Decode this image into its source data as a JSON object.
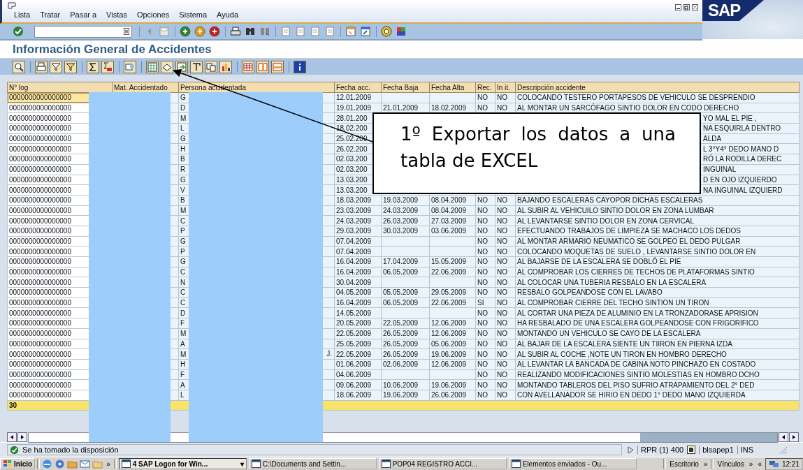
{
  "window": {
    "menu": [
      "Lista",
      "Tratar",
      "Pasar a",
      "Vistas",
      "Opciones",
      "Sistema",
      "Ayuda"
    ],
    "logo": "SAP"
  },
  "title": "Información General de Accidentes",
  "table": {
    "columns": [
      "N° log",
      "Mat. Accidentado",
      "Persona accidentada",
      "Fecha acc.",
      "Fecha Baja",
      "Fecha Alta",
      "Rec.",
      "In it.",
      "Descripción accidente"
    ],
    "rows": [
      {
        "kind": "full",
        "selected": true,
        "log": "0000000000000000",
        "persona": "G",
        "fecha_acc": "12.01.2009",
        "rec": "NO",
        "init": "NO",
        "desc": "COLOCANDO TESTERO PORTAPESOS DE VEHICULO SE DESPRENDIO"
      },
      {
        "kind": "full",
        "selected": false,
        "log": "0000000000000000",
        "persona": "D",
        "fecha_acc": "19.01.2009",
        "fecha_baja": "21.01.2009",
        "fecha_alta": "18.02.2009",
        "rec": "NO",
        "init": "NO",
        "desc": "AL MONTAR UN SARCÓFAGO SINTIO DOLOR EN CODO DERECHO"
      },
      {
        "kind": "covered",
        "selected": false,
        "log": "0000000000000000",
        "persona": "M",
        "fecha_acc": "28.01.200",
        "desc": "YO MAL EL PIE ,"
      },
      {
        "kind": "covered",
        "selected": false,
        "log": "0000000000000000",
        "persona": "L",
        "fecha_acc": "18.02.200",
        "desc": "NA ESQUIRLA DENTRO"
      },
      {
        "kind": "covered",
        "selected": false,
        "log": "0000000000000000",
        "persona": "G",
        "fecha_acc": "25.02.200",
        "desc": "ALDA"
      },
      {
        "kind": "covered",
        "selected": false,
        "log": "0000000000000000",
        "persona": "H",
        "fecha_acc": "26.02.200",
        "desc": "L 3°Y4° DEDO MANO D"
      },
      {
        "kind": "covered",
        "selected": false,
        "log": "0000000000000000",
        "persona": "B",
        "fecha_acc": "02.03.200",
        "desc": "RÓ LA RODILLA DEREC"
      },
      {
        "kind": "covered",
        "selected": false,
        "log": "0000000000000000",
        "persona": "R",
        "fecha_acc": "02.03.200",
        "desc": "INGUINAL"
      },
      {
        "kind": "covered",
        "selected": false,
        "log": "0000000000000000",
        "persona": "G",
        "fecha_acc": "13.03.200",
        "desc": "D EN OJO IZQUIERDO"
      },
      {
        "kind": "covered",
        "selected": false,
        "log": "0000000000000000",
        "persona": "V",
        "fecha_acc": "13.03.200",
        "desc": "NA INGUINAL IZQUIERD"
      },
      {
        "kind": "full",
        "selected": false,
        "log": "0000000000000000",
        "persona": "B",
        "fecha_acc": "18.03.2009",
        "fecha_baja": "19.03.2009",
        "fecha_alta": "08.04.2009",
        "rec": "NO",
        "init": "NO",
        "desc": "BAJANDO ESCALERAS  CAYOPOR DICHAS ESCALERAS"
      },
      {
        "kind": "full",
        "selected": false,
        "log": "0000000000000000",
        "persona": "M",
        "fecha_acc": "23.03.2009",
        "fecha_baja": "24.03.2009",
        "fecha_alta": "08.04.2009",
        "rec": "NO",
        "init": "NO",
        "desc": "AL SUBIR AL VEHICUILO SINTIO DOLOR EN ZONA LUMBAR"
      },
      {
        "kind": "full",
        "selected": false,
        "log": "0000000000000000",
        "persona": "C",
        "fecha_acc": "24.03.2009",
        "fecha_baja": "26.03.2009",
        "fecha_alta": "27.03.2009",
        "rec": "NO",
        "init": "NO",
        "desc": "AL LEVANTARSE SINTIO DOLOR EN ZONA CERVICAL"
      },
      {
        "kind": "full",
        "selected": false,
        "log": "0000000000000000",
        "persona": "P",
        "fecha_acc": "29.03.2009",
        "fecha_baja": "30.03.2009",
        "fecha_alta": "03.06.2009",
        "rec": "NO",
        "init": "NO",
        "desc": "EFECTUANDO TRABAJOS DE LIMPIEZA SE MACHACO LOS DEDOS"
      },
      {
        "kind": "full",
        "selected": false,
        "log": "0000000000000000",
        "persona": "G",
        "fecha_acc": "07.04.2009",
        "rec": "NO",
        "init": "NO",
        "desc": "AL MONTAR ARMARIO NEUMATICO SE GOLPEO EL DEDO PULGAR"
      },
      {
        "kind": "full",
        "selected": false,
        "log": "0000000000000000",
        "persona": "P",
        "fecha_acc": "07.04.2009",
        "rec": "NO",
        "init": "NO",
        "desc": "COLOCANDO MOQUETAS DE SUELO , LEVANTARSE SINTIO DOLOR EN"
      },
      {
        "kind": "full",
        "selected": false,
        "log": "0000000000000000",
        "persona": "G",
        "fecha_acc": "16.04.2009",
        "fecha_baja": "17.04.2009",
        "fecha_alta": "15.05.2009",
        "rec": "NO",
        "init": "NO",
        "desc": "AL BAJARSE DE LA ESCALERA SE DOBLÓ EL PIE"
      },
      {
        "kind": "full",
        "selected": false,
        "log": "0000000000000000",
        "persona": "C",
        "fecha_acc": "16.04.2009",
        "fecha_baja": "06.05.2009",
        "fecha_alta": "22.06.2009",
        "rec": "NO",
        "init": "NO",
        "desc": "AL COMPROBAR LOS CIERRES DE TECHOS DE PLATAFORMAS SINTIO"
      },
      {
        "kind": "full",
        "selected": false,
        "log": "0000000000000000",
        "persona": "N",
        "fecha_acc": "30.04.2009",
        "rec": "NO",
        "init": "NO",
        "desc": "AL COLOCAR UNA TUBERIA RESBALO EN LA ESCALERA"
      },
      {
        "kind": "full",
        "selected": false,
        "log": "0000000000000000",
        "persona": "C",
        "fecha_acc": "04.05.2009",
        "fecha_baja": "05.05.2009",
        "fecha_alta": "29.05.2009",
        "rec": "NO",
        "init": "NO",
        "desc": "RESBALO GOLPEANDOSE CON EL LAVABO"
      },
      {
        "kind": "full",
        "selected": false,
        "log": "0000000000000000",
        "persona": "C",
        "fecha_acc": "16.04.2009",
        "fecha_baja": "06.05.2009",
        "fecha_alta": "22.06.2009",
        "rec": "SI",
        "init": "NO",
        "desc": "AL COMPROBAR CIERRE DEL TECHO SINTION UN TIRON"
      },
      {
        "kind": "full",
        "selected": false,
        "log": "0000000000000000",
        "persona": "D",
        "fecha_acc": "14.05.2009",
        "rec": "NO",
        "init": "NO",
        "desc": "AL CORTAR UNA PIEZA DE ALUMINIO EN LA TRONZADORASE APRISION"
      },
      {
        "kind": "full",
        "selected": false,
        "log": "0000000000000000",
        "persona": "F",
        "fecha_acc": "20.05.2009",
        "fecha_baja": "22.05.2009",
        "fecha_alta": "12.06.2009",
        "rec": "NO",
        "init": "NO",
        "desc": "HA RESBALADO DE UNA ESCALERA GOLPEANDOSE CON FRIGORIFICO"
      },
      {
        "kind": "full",
        "selected": false,
        "log": "0000000000000000",
        "persona": "M",
        "fecha_acc": "22.05.2009",
        "fecha_baja": "26.05.2009",
        "fecha_alta": "12.06.2009",
        "rec": "NO",
        "init": "NO",
        "desc": "MONTANDO UN VEHICULO SE CAYO DE LA ESCALERA"
      },
      {
        "kind": "full",
        "selected": false,
        "log": "0000000000000000",
        "persona": "A",
        "fecha_acc": "25.05.2009",
        "fecha_baja": "26.05.2009",
        "fecha_alta": "05.06.2009",
        "rec": "NO",
        "init": "NO",
        "desc": "AL BAJAR DE LA ESCALERA SIENTE UN TIIRON EN PIERNA IZDA"
      },
      {
        "kind": "full",
        "selected": false,
        "log": "0000000000000000",
        "persona": "M",
        "persona_end": "J.",
        "fecha_acc": "22.05.2009",
        "fecha_baja": "26.05.2009",
        "fecha_alta": "19.06.2009",
        "rec": "NO",
        "init": "NO",
        "desc": "AL SUBIR AL COCHE ,NOTE UN TIRON EN HOMBRO DERECHO"
      },
      {
        "kind": "full",
        "selected": false,
        "log": "0000000000000000",
        "persona": "H",
        "fecha_acc": "01.06.2009",
        "fecha_baja": "02.06.2009",
        "fecha_alta": "12.06.2009",
        "rec": "NO",
        "init": "NO",
        "desc": "AL LEVANTAR LA BANCADA DE CABINA NOTO PINCHAZO EN COSTADO"
      },
      {
        "kind": "full",
        "selected": false,
        "log": "0000000000000000",
        "persona": "F",
        "fecha_acc": "04.06.2009",
        "rec": "NO",
        "init": "NO",
        "desc": "REALIZANDO MODIFICACIONES SINTIO MOLESTIAS EN HOMBRO DCHO"
      },
      {
        "kind": "full",
        "selected": false,
        "log": "0000000000000000",
        "persona": "A",
        "fecha_acc": "09.06.2009",
        "fecha_baja": "10.06.2009",
        "fecha_alta": "19.06.2009",
        "rec": "NO",
        "init": "NO",
        "desc": "MONTANDO TABLEROS DEL PISO SUFRIO ATRAPAMIENTO DEL 2° DED"
      },
      {
        "kind": "full",
        "selected": false,
        "log": "0000000000000000",
        "persona": "L",
        "fecha_acc": "18.06.2009",
        "fecha_baja": "19.06.2009",
        "fecha_alta": "26.06.2009",
        "rec": "NO",
        "init": "NO",
        "desc": "CON AVELLANADOR SE HIRIO EN DEDO 1° DEDO MANO IZQUIERDA"
      }
    ],
    "total": "30"
  },
  "callout": {
    "text": "1º Exportar los datos a una tabla de EXCEL"
  },
  "status_bar": {
    "message": "Se ha tomado la disposición",
    "system": "RPR (1) 400",
    "server": "blsapep1",
    "mode": "INS"
  },
  "taskbar": {
    "start": "Inicio",
    "more": "»",
    "tasks": [
      {
        "label": "4 SAP Logon for Win...",
        "selected": true,
        "caret": "▾"
      },
      {
        "label": "C:\\Documents and Settin...",
        "selected": false
      },
      {
        "label": "POP04 REGISTRO ACCI...",
        "selected": false
      },
      {
        "label": "Elementos enviados - Ou...",
        "selected": false
      }
    ],
    "toolbars": [
      {
        "label": "Escritorio",
        "more": "»"
      },
      {
        "label": "Vínculos",
        "more": "»"
      }
    ],
    "collapse": "«",
    "clock": "12:21"
  }
}
